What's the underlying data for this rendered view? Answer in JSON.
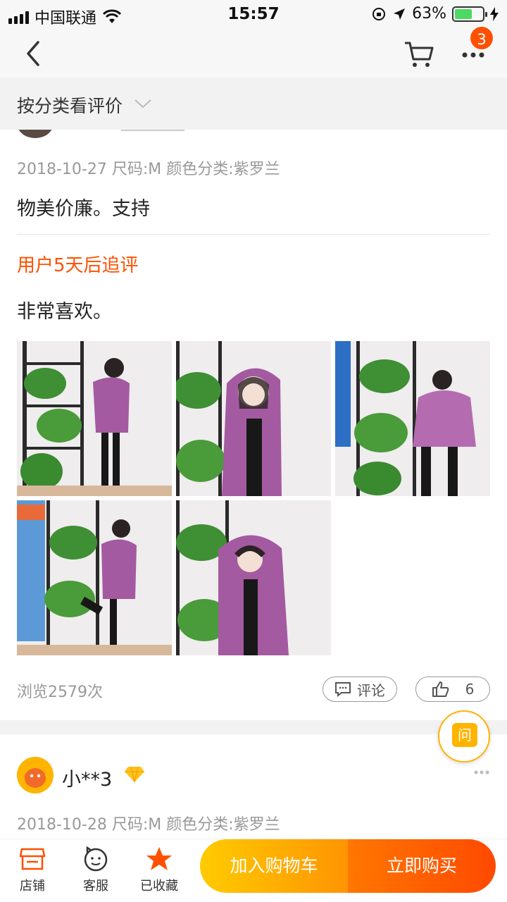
{
  "status_bar": {
    "carrier": "中国联通",
    "time": "15:57",
    "battery": "63%",
    "battery_level": 0.63
  },
  "nav": {
    "cart_badge": "3",
    "icons": [
      "back-icon",
      "cart-icon",
      "more-icon"
    ]
  },
  "filter": {
    "label": "按分类看评价"
  },
  "review1": {
    "meta": "2018-10-27  尺码:M  颜色分类:紫罗兰",
    "content": "物美价廉。支持",
    "followup_label": "用户5天后追评",
    "followup_content": "非常喜欢。",
    "photo_count": 5,
    "views": "浏览2579次",
    "comment_label": "评论",
    "like_count": "6"
  },
  "ask_button": {
    "label": "问"
  },
  "review2": {
    "username": "小**3",
    "meta": "2018-10-28  尺码:M  颜色分类:紫罗兰"
  },
  "bottom_bar": {
    "store": "店铺",
    "service": "客服",
    "favorite": "已收藏",
    "add_cart": "加入购物车",
    "buy_now": "立即购买"
  },
  "colors": {
    "accent": "#ff5000",
    "jacket": "#a45aa0",
    "cart_button": "#ffb400",
    "buy_button": "#ff5000"
  }
}
